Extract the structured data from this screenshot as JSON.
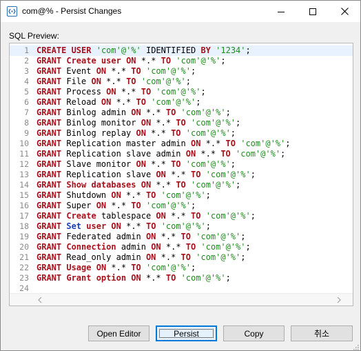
{
  "window": {
    "title": "com@% - Persist Changes",
    "icon": "sql-app-icon",
    "controls": [
      "minimize-icon",
      "maximize-icon",
      "close-icon"
    ]
  },
  "sql_preview": {
    "label": "SQL Preview:",
    "current_line": 1,
    "lines": [
      {
        "n": "1",
        "tokens": [
          {
            "t": "CREATE USER",
            "c": "kw"
          },
          {
            "t": " "
          },
          {
            "t": "'com'@'%'",
            "c": "str"
          },
          {
            "t": " IDENTIFIED "
          },
          {
            "t": "BY",
            "c": "kw"
          },
          {
            "t": " "
          },
          {
            "t": "'1234'",
            "c": "str"
          },
          {
            "t": ";"
          }
        ]
      },
      {
        "n": "2",
        "tokens": [
          {
            "t": "GRANT",
            "c": "kw"
          },
          {
            "t": " "
          },
          {
            "t": "Create user",
            "c": "kw"
          },
          {
            "t": " "
          },
          {
            "t": "ON",
            "c": "kw"
          },
          {
            "t": " *.* "
          },
          {
            "t": "TO",
            "c": "kw"
          },
          {
            "t": " "
          },
          {
            "t": "'com'@'%'",
            "c": "str"
          },
          {
            "t": ";"
          }
        ]
      },
      {
        "n": "3",
        "tokens": [
          {
            "t": "GRANT",
            "c": "kw"
          },
          {
            "t": " Event "
          },
          {
            "t": "ON",
            "c": "kw"
          },
          {
            "t": " *.* "
          },
          {
            "t": "TO",
            "c": "kw"
          },
          {
            "t": " "
          },
          {
            "t": "'com'@'%'",
            "c": "str"
          },
          {
            "t": ";"
          }
        ]
      },
      {
        "n": "4",
        "tokens": [
          {
            "t": "GRANT",
            "c": "kw"
          },
          {
            "t": " File "
          },
          {
            "t": "ON",
            "c": "kw"
          },
          {
            "t": " *.* "
          },
          {
            "t": "TO",
            "c": "kw"
          },
          {
            "t": " "
          },
          {
            "t": "'com'@'%'",
            "c": "str"
          },
          {
            "t": ";"
          }
        ]
      },
      {
        "n": "5",
        "tokens": [
          {
            "t": "GRANT",
            "c": "kw"
          },
          {
            "t": " Process "
          },
          {
            "t": "ON",
            "c": "kw"
          },
          {
            "t": " *.* "
          },
          {
            "t": "TO",
            "c": "kw"
          },
          {
            "t": " "
          },
          {
            "t": "'com'@'%'",
            "c": "str"
          },
          {
            "t": ";"
          }
        ]
      },
      {
        "n": "6",
        "tokens": [
          {
            "t": "GRANT",
            "c": "kw"
          },
          {
            "t": " Reload "
          },
          {
            "t": "ON",
            "c": "kw"
          },
          {
            "t": " *.* "
          },
          {
            "t": "TO",
            "c": "kw"
          },
          {
            "t": " "
          },
          {
            "t": "'com'@'%'",
            "c": "str"
          },
          {
            "t": ";"
          }
        ]
      },
      {
        "n": "7",
        "tokens": [
          {
            "t": "GRANT",
            "c": "kw"
          },
          {
            "t": " Binlog admin "
          },
          {
            "t": "ON",
            "c": "kw"
          },
          {
            "t": " *.* "
          },
          {
            "t": "TO",
            "c": "kw"
          },
          {
            "t": " "
          },
          {
            "t": "'com'@'%'",
            "c": "str"
          },
          {
            "t": ";"
          }
        ]
      },
      {
        "n": "8",
        "tokens": [
          {
            "t": "GRANT",
            "c": "kw"
          },
          {
            "t": " Binlog monitor "
          },
          {
            "t": "ON",
            "c": "kw"
          },
          {
            "t": " *.* "
          },
          {
            "t": "TO",
            "c": "kw"
          },
          {
            "t": " "
          },
          {
            "t": "'com'@'%'",
            "c": "str"
          },
          {
            "t": ";"
          }
        ]
      },
      {
        "n": "9",
        "tokens": [
          {
            "t": "GRANT",
            "c": "kw"
          },
          {
            "t": " Binlog replay "
          },
          {
            "t": "ON",
            "c": "kw"
          },
          {
            "t": " *.* "
          },
          {
            "t": "TO",
            "c": "kw"
          },
          {
            "t": " "
          },
          {
            "t": "'com'@'%'",
            "c": "str"
          },
          {
            "t": ";"
          }
        ]
      },
      {
        "n": "10",
        "tokens": [
          {
            "t": "GRANT",
            "c": "kw"
          },
          {
            "t": " Replication master admin "
          },
          {
            "t": "ON",
            "c": "kw"
          },
          {
            "t": " *.* "
          },
          {
            "t": "TO",
            "c": "kw"
          },
          {
            "t": " "
          },
          {
            "t": "'com'@'%'",
            "c": "str"
          },
          {
            "t": ";"
          }
        ]
      },
      {
        "n": "11",
        "tokens": [
          {
            "t": "GRANT",
            "c": "kw"
          },
          {
            "t": " Replication slave admin "
          },
          {
            "t": "ON",
            "c": "kw"
          },
          {
            "t": " *.* "
          },
          {
            "t": "TO",
            "c": "kw"
          },
          {
            "t": " "
          },
          {
            "t": "'com'@'%'",
            "c": "str"
          },
          {
            "t": ";"
          }
        ]
      },
      {
        "n": "12",
        "tokens": [
          {
            "t": "GRANT",
            "c": "kw"
          },
          {
            "t": " Slave monitor "
          },
          {
            "t": "ON",
            "c": "kw"
          },
          {
            "t": " *.* "
          },
          {
            "t": "TO",
            "c": "kw"
          },
          {
            "t": " "
          },
          {
            "t": "'com'@'%'",
            "c": "str"
          },
          {
            "t": ";"
          }
        ]
      },
      {
        "n": "13",
        "tokens": [
          {
            "t": "GRANT",
            "c": "kw"
          },
          {
            "t": " Replication slave "
          },
          {
            "t": "ON",
            "c": "kw"
          },
          {
            "t": " *.* "
          },
          {
            "t": "TO",
            "c": "kw"
          },
          {
            "t": " "
          },
          {
            "t": "'com'@'%'",
            "c": "str"
          },
          {
            "t": ";"
          }
        ]
      },
      {
        "n": "14",
        "tokens": [
          {
            "t": "GRANT",
            "c": "kw"
          },
          {
            "t": " "
          },
          {
            "t": "Show databases",
            "c": "kw"
          },
          {
            "t": " "
          },
          {
            "t": "ON",
            "c": "kw"
          },
          {
            "t": " *.* "
          },
          {
            "t": "TO",
            "c": "kw"
          },
          {
            "t": " "
          },
          {
            "t": "'com'@'%'",
            "c": "str"
          },
          {
            "t": ";"
          }
        ]
      },
      {
        "n": "15",
        "tokens": [
          {
            "t": "GRANT",
            "c": "kw"
          },
          {
            "t": " Shutdown "
          },
          {
            "t": "ON",
            "c": "kw"
          },
          {
            "t": " *.* "
          },
          {
            "t": "TO",
            "c": "kw"
          },
          {
            "t": " "
          },
          {
            "t": "'com'@'%'",
            "c": "str"
          },
          {
            "t": ";"
          }
        ]
      },
      {
        "n": "16",
        "tokens": [
          {
            "t": "GRANT",
            "c": "kw"
          },
          {
            "t": " Super "
          },
          {
            "t": "ON",
            "c": "kw"
          },
          {
            "t": " *.* "
          },
          {
            "t": "TO",
            "c": "kw"
          },
          {
            "t": " "
          },
          {
            "t": "'com'@'%'",
            "c": "str"
          },
          {
            "t": ";"
          }
        ]
      },
      {
        "n": "17",
        "tokens": [
          {
            "t": "GRANT",
            "c": "kw"
          },
          {
            "t": " "
          },
          {
            "t": "Create",
            "c": "kw"
          },
          {
            "t": " tablespace "
          },
          {
            "t": "ON",
            "c": "kw"
          },
          {
            "t": " *.* "
          },
          {
            "t": "TO",
            "c": "kw"
          },
          {
            "t": " "
          },
          {
            "t": "'com'@'%'",
            "c": "str"
          },
          {
            "t": ";"
          }
        ]
      },
      {
        "n": "18",
        "tokens": [
          {
            "t": "GRANT",
            "c": "kw"
          },
          {
            "t": " "
          },
          {
            "t": "Set",
            "c": "kw2"
          },
          {
            "t": " "
          },
          {
            "t": "user",
            "c": "kw"
          },
          {
            "t": " "
          },
          {
            "t": "ON",
            "c": "kw"
          },
          {
            "t": " *.* "
          },
          {
            "t": "TO",
            "c": "kw"
          },
          {
            "t": " "
          },
          {
            "t": "'com'@'%'",
            "c": "str"
          },
          {
            "t": ";"
          }
        ]
      },
      {
        "n": "19",
        "tokens": [
          {
            "t": "GRANT",
            "c": "kw"
          },
          {
            "t": " Federated admin "
          },
          {
            "t": "ON",
            "c": "kw"
          },
          {
            "t": " *.* "
          },
          {
            "t": "TO",
            "c": "kw"
          },
          {
            "t": " "
          },
          {
            "t": "'com'@'%'",
            "c": "str"
          },
          {
            "t": ";"
          }
        ]
      },
      {
        "n": "20",
        "tokens": [
          {
            "t": "GRANT",
            "c": "kw"
          },
          {
            "t": " "
          },
          {
            "t": "Connection",
            "c": "kw"
          },
          {
            "t": " admin "
          },
          {
            "t": "ON",
            "c": "kw"
          },
          {
            "t": " *.* "
          },
          {
            "t": "TO",
            "c": "kw"
          },
          {
            "t": " "
          },
          {
            "t": "'com'@'%'",
            "c": "str"
          },
          {
            "t": ";"
          }
        ]
      },
      {
        "n": "21",
        "tokens": [
          {
            "t": "GRANT",
            "c": "kw"
          },
          {
            "t": " Read_only admin "
          },
          {
            "t": "ON",
            "c": "kw"
          },
          {
            "t": " *.* "
          },
          {
            "t": "TO",
            "c": "kw"
          },
          {
            "t": " "
          },
          {
            "t": "'com'@'%'",
            "c": "str"
          },
          {
            "t": ";"
          }
        ]
      },
      {
        "n": "22",
        "tokens": [
          {
            "t": "GRANT",
            "c": "kw"
          },
          {
            "t": " "
          },
          {
            "t": "Usage",
            "c": "kw"
          },
          {
            "t": " "
          },
          {
            "t": "ON",
            "c": "kw"
          },
          {
            "t": " *.* "
          },
          {
            "t": "TO",
            "c": "kw"
          },
          {
            "t": " "
          },
          {
            "t": "'com'@'%'",
            "c": "str"
          },
          {
            "t": ";"
          }
        ]
      },
      {
        "n": "23",
        "tokens": [
          {
            "t": "GRANT",
            "c": "kw"
          },
          {
            "t": " "
          },
          {
            "t": "Grant option",
            "c": "kw"
          },
          {
            "t": " "
          },
          {
            "t": "ON",
            "c": "kw"
          },
          {
            "t": " *.* "
          },
          {
            "t": "TO",
            "c": "kw"
          },
          {
            "t": " "
          },
          {
            "t": "'com'@'%'",
            "c": "str"
          },
          {
            "t": ";"
          }
        ]
      },
      {
        "n": "24",
        "tokens": []
      }
    ]
  },
  "buttons": {
    "open_editor": "Open Editor",
    "persist": "Persist",
    "copy": "Copy",
    "cancel": "취소"
  },
  "colors": {
    "keyword": "#a8111c",
    "keyword_alt": "#1c3dbd",
    "string": "#1f8a1f",
    "current_line_bg": "#e8f2fe",
    "focus_border": "#0078d7"
  }
}
